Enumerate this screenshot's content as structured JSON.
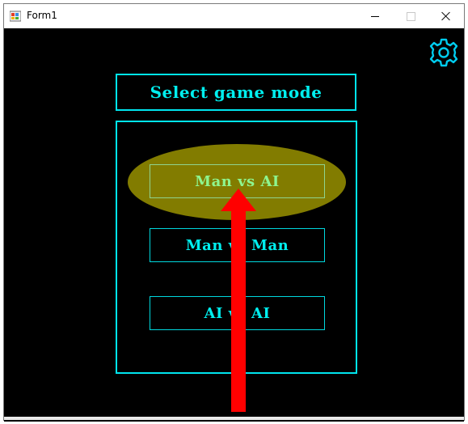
{
  "window": {
    "title": "Form1",
    "icons": {
      "app": "winforms-app-icon",
      "minimize": "minimize-icon",
      "maximize": "maximize-icon",
      "close": "close-icon"
    }
  },
  "toolbar": {
    "settings_icon": "gear-icon",
    "accent_color": "#00ccee"
  },
  "heading": {
    "label": "Select game mode"
  },
  "modes": [
    {
      "label": "Man vs AI",
      "highlighted": true
    },
    {
      "label": "Man vs Man",
      "highlighted": false
    },
    {
      "label": "AI vs AI",
      "highlighted": false
    }
  ],
  "annotation": {
    "type": "red-arrow-up",
    "color": "#ff0000",
    "highlight_color": "#827c00"
  }
}
